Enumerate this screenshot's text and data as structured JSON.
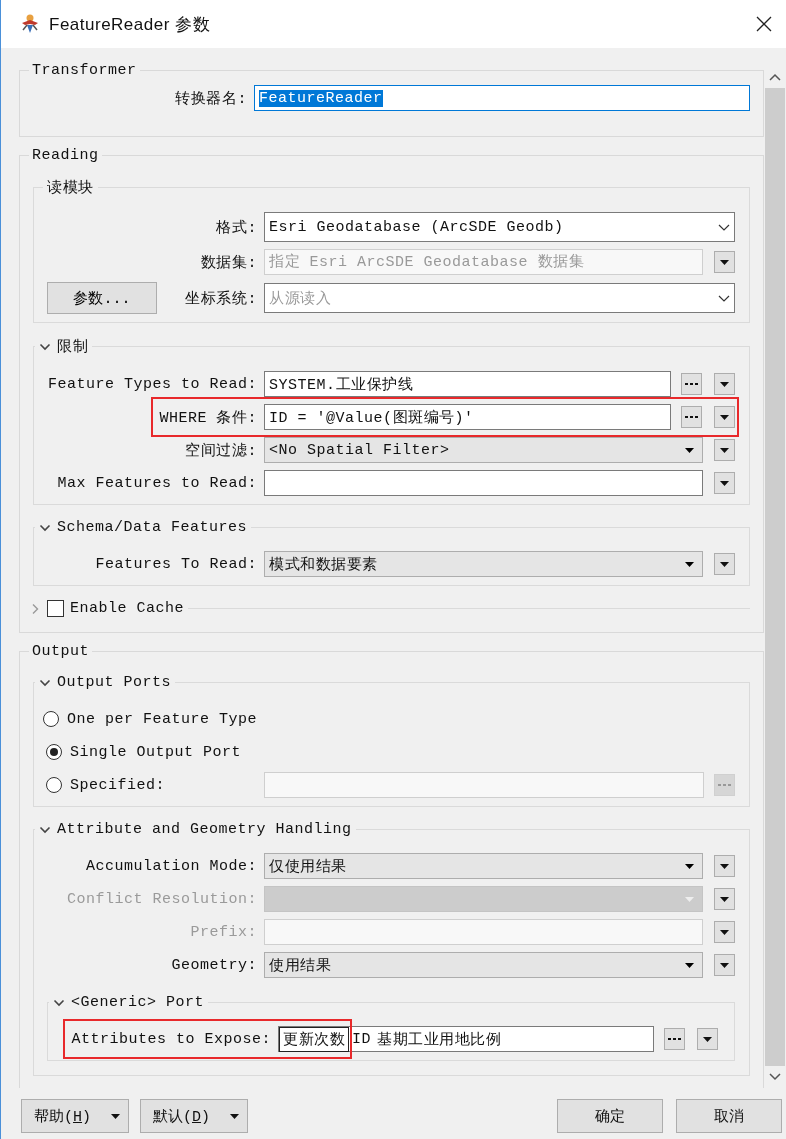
{
  "window": {
    "title": "FeatureReader 参数"
  },
  "groups": [
    {
      "title": "Transformer",
      "rows": [
        {
          "kind": "field",
          "label": "转换器名:",
          "disabled": false,
          "field": {
            "kind": "text",
            "value": "FeatureReader",
            "text_selected": true,
            "disabled": false
          }
        }
      ]
    },
    {
      "title": "Reading",
      "sections": [
        {
          "title": "读模块",
          "rows": [
            {
              "kind": "field",
              "label": "格式:",
              "disabled": false,
              "field": {
                "kind": "combo",
                "value": "Esri Geodatabase (ArcSDE Geodb)",
                "disabled": false
              }
            },
            {
              "kind": "field",
              "label": "数据集:",
              "disabled": false,
              "field": {
                "kind": "text",
                "placeholder": "指定 Esri ArcSDE Geodatabase 数据集",
                "disabled": true
              },
              "buttons": [
                {
                  "kind": "menu",
                  "disabled": false
                }
              ]
            },
            {
              "kind": "field",
              "label": "坐标系统:",
              "side_button": "参数...",
              "disabled": false,
              "field": {
                "kind": "combo",
                "placeholder": "从源读入",
                "disabled": false
              }
            }
          ]
        },
        {
          "title": "限制",
          "expanded": true,
          "rows": [
            {
              "kind": "field",
              "label": "Feature Types to Read:",
              "disabled": false,
              "field": {
                "kind": "text",
                "value": "SYSTEM.工业保护线",
                "disabled": false
              },
              "buttons": [
                {
                  "kind": "more",
                  "disabled": false
                },
                {
                  "kind": "menu",
                  "disabled": false
                }
              ]
            },
            {
              "kind": "field",
              "label": "WHERE 条件:",
              "disabled": false,
              "highlighted": true,
              "field": {
                "kind": "text",
                "value": "ID = '@Value(图斑编号)'",
                "disabled": false
              },
              "buttons": [
                {
                  "kind": "more",
                  "disabled": false
                },
                {
                  "kind": "menu",
                  "disabled": false
                }
              ]
            },
            {
              "kind": "field",
              "label": "空间过滤:",
              "disabled": false,
              "field": {
                "kind": "select",
                "value": "<No Spatial Filter>",
                "disabled": false
              },
              "buttons": [
                {
                  "kind": "menu",
                  "disabled": false
                }
              ]
            },
            {
              "kind": "field",
              "label": "Max Features to Read:",
              "disabled": false,
              "field": {
                "kind": "text",
                "disabled": false
              },
              "buttons": [
                {
                  "kind": "menu",
                  "disabled": false
                }
              ]
            }
          ]
        },
        {
          "title": "Schema/Data Features",
          "expanded": true,
          "rows": [
            {
              "kind": "field",
              "label": "Features To Read:",
              "disabled": false,
              "field": {
                "kind": "select",
                "value": "模式和数据要素",
                "disabled": false
              },
              "buttons": [
                {
                  "kind": "menu",
                  "disabled": false
                }
              ]
            }
          ]
        },
        {
          "title": "Enable Cache",
          "expanded": false,
          "checked": false
        }
      ]
    },
    {
      "title": "Output",
      "sections": [
        {
          "title": "Output Ports",
          "expanded": true,
          "rows": [
            {
              "kind": "radio",
              "label": "One per Feature Type",
              "selected": false
            },
            {
              "kind": "radio",
              "label": "Single Output Port",
              "selected": true
            },
            {
              "kind": "radio",
              "label": "Specified:",
              "selected": false,
              "field": {
                "kind": "text",
                "disabled": true
              },
              "buttons": [
                {
                  "kind": "more",
                  "disabled": true
                }
              ]
            }
          ]
        },
        {
          "title": "Attribute and Geometry Handling",
          "expanded": true,
          "rows": [
            {
              "kind": "field",
              "label": "Accumulation Mode:",
              "disabled": false,
              "field": {
                "kind": "select",
                "value": "仅使用结果",
                "disabled": false
              },
              "buttons": [
                {
                  "kind": "menu",
                  "disabled": false
                }
              ]
            },
            {
              "kind": "field",
              "label": "Conflict Resolution:",
              "disabled": true,
              "field": {
                "kind": "select",
                "disabled": true
              },
              "buttons": [
                {
                  "kind": "menu",
                  "disabled": false
                }
              ]
            },
            {
              "kind": "field",
              "label": "Prefix:",
              "disabled": true,
              "field": {
                "kind": "text",
                "disabled": true
              },
              "buttons": [
                {
                  "kind": "menu",
                  "disabled": false
                }
              ]
            },
            {
              "kind": "field",
              "label": "Geometry:",
              "disabled": false,
              "field": {
                "kind": "select",
                "value": "使用结果",
                "disabled": false
              },
              "buttons": [
                {
                  "kind": "menu",
                  "disabled": false
                }
              ]
            }
          ],
          "sections": [
            {
              "title": "<Generic> Port",
              "expanded": true,
              "rows": [
                {
                  "kind": "field",
                  "label": "Attributes to Expose:",
                  "disabled": false,
                  "highlighted": true,
                  "field": {
                    "kind": "tags",
                    "disabled": false,
                    "tokens": [
                      {
                        "text": "更新次数",
                        "boxed": true
                      },
                      {
                        "text": "ID",
                        "boxed": false
                      },
                      {
                        "text": "基期工业用地比例",
                        "boxed": false
                      }
                    ]
                  },
                  "buttons": [
                    {
                      "kind": "more",
                      "disabled": false
                    },
                    {
                      "kind": "menu",
                      "disabled": false
                    }
                  ]
                }
              ]
            }
          ]
        }
      ]
    }
  ],
  "buttons": [
    {
      "kind": "split",
      "text": "帮助(",
      "key": "H",
      "text_after": ")"
    },
    {
      "kind": "split",
      "text": "默认(",
      "key": "D",
      "text_after": ")"
    },
    {
      "kind": "plain",
      "text": "确定"
    },
    {
      "kind": "plain",
      "text": "取消"
    }
  ]
}
